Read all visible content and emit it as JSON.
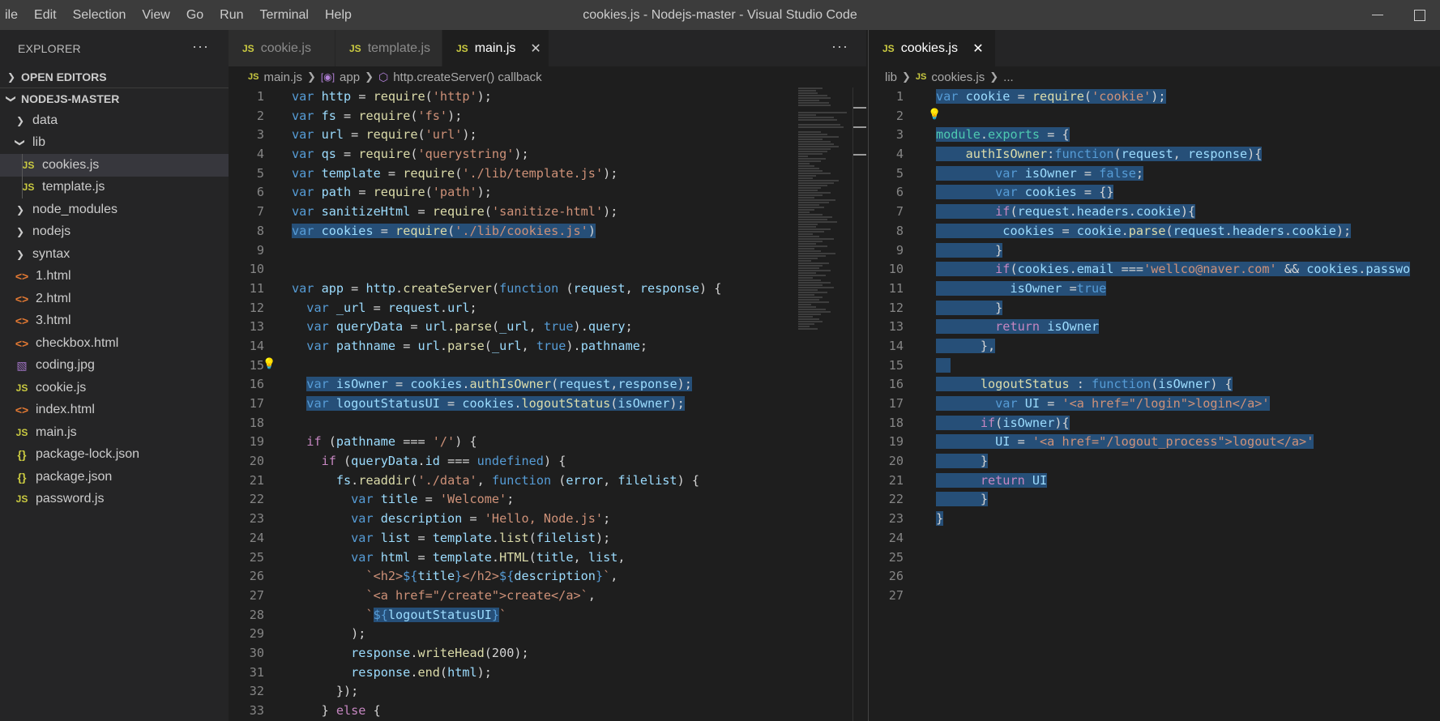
{
  "menu": [
    "ile",
    "Edit",
    "Selection",
    "View",
    "Go",
    "Run",
    "Terminal",
    "Help"
  ],
  "window_title": "cookies.js - Nodejs-master - Visual Studio Code",
  "sidebar": {
    "title": "EXPLORER",
    "more": "···",
    "open_editors": "OPEN EDITORS",
    "project": "NODEJS-MASTER",
    "tree": [
      {
        "label": "data",
        "kind": "folder-closed",
        "depth": 0
      },
      {
        "label": "lib",
        "kind": "folder-open",
        "depth": 0
      },
      {
        "label": "cookies.js",
        "kind": "js",
        "depth": 1,
        "selected": true
      },
      {
        "label": "template.js",
        "kind": "js",
        "depth": 1
      },
      {
        "label": "node_modules",
        "kind": "folder-closed",
        "depth": 0
      },
      {
        "label": "nodejs",
        "kind": "folder-closed",
        "depth": 0
      },
      {
        "label": "syntax",
        "kind": "folder-closed",
        "depth": 0
      },
      {
        "label": "1.html",
        "kind": "html",
        "depth": 0
      },
      {
        "label": "2.html",
        "kind": "html",
        "depth": 0
      },
      {
        "label": "3.html",
        "kind": "html",
        "depth": 0
      },
      {
        "label": "checkbox.html",
        "kind": "html",
        "depth": 0
      },
      {
        "label": "coding.jpg",
        "kind": "img",
        "depth": 0
      },
      {
        "label": "cookie.js",
        "kind": "js",
        "depth": 0
      },
      {
        "label": "index.html",
        "kind": "html",
        "depth": 0
      },
      {
        "label": "main.js",
        "kind": "js",
        "depth": 0
      },
      {
        "label": "package-lock.json",
        "kind": "json",
        "depth": 0
      },
      {
        "label": "package.json",
        "kind": "json",
        "depth": 0
      },
      {
        "label": "password.js",
        "kind": "js",
        "depth": 0
      }
    ]
  },
  "group1": {
    "tabs": [
      {
        "label": "cookie.js",
        "active": false
      },
      {
        "label": "template.js",
        "active": false
      },
      {
        "label": "main.js",
        "active": true
      }
    ],
    "more": "···",
    "breadcrumb": {
      "file": "main.js",
      "scope": "app",
      "callback": "http.createServer() callback"
    },
    "lines": [
      {
        "n": "1",
        "h": "<span class='k'>var</span> <span class='v'>http</span> = <span class='f'>require</span>(<span class='s'>'http'</span>);"
      },
      {
        "n": "2",
        "h": "<span class='k'>var</span> <span class='v'>fs</span> = <span class='f'>require</span>(<span class='s'>'fs'</span>);"
      },
      {
        "n": "3",
        "h": "<span class='k'>var</span> <span class='v'>url</span> = <span class='f'>require</span>(<span class='s'>'url'</span>);"
      },
      {
        "n": "4",
        "h": "<span class='k'>var</span> <span class='v'>qs</span> = <span class='f'>require</span>(<span class='s'>'querystring'</span>);"
      },
      {
        "n": "5",
        "h": "<span class='k'>var</span> <span class='v'>template</span> = <span class='f'>require</span>(<span class='s'>'./lib/template.js'</span>);"
      },
      {
        "n": "6",
        "h": "<span class='k'>var</span> <span class='v'>path</span> = <span class='f'>require</span>(<span class='s'>'path'</span>);"
      },
      {
        "n": "7",
        "h": "<span class='k'>var</span> <span class='v'>sanitizeHtml</span> = <span class='f'>require</span>(<span class='s'>'sanitize-html'</span>);"
      },
      {
        "n": "8",
        "h": "<span class='sel'><span class='k'>var</span> <span class='v'>cookies</span> = <span class='f'>require</span>(<span class='s'>'./lib/cookies.js'</span>)</span>"
      },
      {
        "n": "9",
        "h": ""
      },
      {
        "n": "10",
        "h": ""
      },
      {
        "n": "11",
        "h": "<span class='k'>var</span> <span class='v'>app</span> = <span class='v'>http</span>.<span class='f'>createServer</span>(<span class='k'>function</span> (<span class='v'>request</span>, <span class='v'>response</span>) {"
      },
      {
        "n": "12",
        "h": "  <span class='k'>var</span> <span class='v'>_url</span> = <span class='v'>request</span>.<span class='v'>url</span>;"
      },
      {
        "n": "13",
        "h": "  <span class='k'>var</span> <span class='v'>queryData</span> = <span class='v'>url</span>.<span class='f'>parse</span>(<span class='v'>_url</span>, <span class='k'>true</span>).<span class='v'>query</span>;"
      },
      {
        "n": "14",
        "h": "  <span class='k'>var</span> <span class='v'>pathname</span> = <span class='v'>url</span>.<span class='f'>parse</span>(<span class='v'>_url</span>, <span class='k'>true</span>).<span class='v'>pathname</span>;"
      },
      {
        "n": "15",
        "h": ""
      },
      {
        "n": "16",
        "h": "  <span class='sel'><span class='k'>var</span> <span class='v'>isOwner</span> = <span class='v'>cookies</span>.<span class='f'>authIsOwner</span>(<span class='v'>request</span>,<span class='v'>response</span>);</span>"
      },
      {
        "n": "17",
        "h": "  <span class='sel'><span class='k'>var</span> <span class='v'>logoutStatusUI</span> = <span class='v'>cookies</span>.<span class='f'>logoutStatus</span>(<span class='v'>isOwner</span>);</span>"
      },
      {
        "n": "18",
        "h": ""
      },
      {
        "n": "19",
        "h": "  <span class='c'>if</span> (<span class='v'>pathname</span> === <span class='s'>'/'</span>) {"
      },
      {
        "n": "20",
        "h": "    <span class='c'>if</span> (<span class='v'>queryData</span>.<span class='v'>id</span> === <span class='k'>undefined</span>) {"
      },
      {
        "n": "21",
        "h": "      <span class='v'>fs</span>.<span class='f'>readdir</span>(<span class='s'>'./data'</span>, <span class='k'>function</span> (<span class='v'>error</span>, <span class='v'>filelist</span>) {"
      },
      {
        "n": "22",
        "h": "        <span class='k'>var</span> <span class='v'>title</span> = <span class='s'>'Welcome'</span>;"
      },
      {
        "n": "23",
        "h": "        <span class='k'>var</span> <span class='v'>description</span> = <span class='s'>'Hello, Node.js'</span>;"
      },
      {
        "n": "24",
        "h": "        <span class='k'>var</span> <span class='v'>list</span> = <span class='v'>template</span>.<span class='f'>list</span>(<span class='v'>filelist</span>);"
      },
      {
        "n": "25",
        "h": "        <span class='k'>var</span> <span class='v'>html</span> = <span class='v'>template</span>.<span class='f'>HTML</span>(<span class='v'>title</span>, <span class='v'>list</span>,"
      },
      {
        "n": "26",
        "h": "          <span class='s'>`&lt;h2&gt;</span><span class='k'>${</span><span class='v'>title</span><span class='k'>}</span><span class='s'>&lt;/h2&gt;</span><span class='k'>${</span><span class='v'>description</span><span class='k'>}</span><span class='s'>`</span>,"
      },
      {
        "n": "27",
        "h": "          <span class='s'>`&lt;a href=\"/create\"&gt;create&lt;/a&gt;`</span>,"
      },
      {
        "n": "28",
        "h": "          <span class='s'>`</span><span class='sel'><span class='k'>${</span><span class='v'>logoutStatusUI</span><span class='k'>}</span></span><span class='s'>`</span>"
      },
      {
        "n": "29",
        "h": "        );"
      },
      {
        "n": "30",
        "h": "        <span class='v'>response</span>.<span class='f'>writeHead</span>(<span class='p'>200</span>);"
      },
      {
        "n": "31",
        "h": "        <span class='v'>response</span>.<span class='f'>end</span>(<span class='v'>html</span>);"
      },
      {
        "n": "32",
        "h": "      });"
      },
      {
        "n": "33",
        "h": "    } <span class='c'>else</span> {"
      }
    ]
  },
  "group2": {
    "tabs": [
      {
        "label": "cookies.js",
        "active": true
      }
    ],
    "breadcrumb": {
      "folder": "lib",
      "file": "cookies.js",
      "rest": "..."
    },
    "lines": [
      {
        "n": "1",
        "h": "<span class='sel'><span class='k'>var</span> <span class='v'>cookie</span> = <span class='f'>require</span>(<span class='s'>'cookie'</span>);</span>"
      },
      {
        "n": "2",
        "h": ""
      },
      {
        "n": "3",
        "h": "<span class='sel'><span class='t'>module</span>.<span class='t'>exports</span> = {</span>"
      },
      {
        "n": "4",
        "h": "<span class='sel'>    <span class='f'>authIsOwner</span>:<span class='k'>function</span>(<span class='v'>request</span>, <span class='v'>response</span>){</span>"
      },
      {
        "n": "5",
        "h": "<span class='sel'>        <span class='k'>var</span> <span class='v'>isOwner</span> = <span class='k'>false</span>;</span>"
      },
      {
        "n": "6",
        "h": "<span class='sel'>        <span class='k'>var</span> <span class='v'>cookies</span> = {}</span>"
      },
      {
        "n": "7",
        "h": "<span class='sel'>        <span class='c'>if</span>(<span class='v'>request</span>.<span class='v'>headers</span>.<span class='v'>cookie</span>){</span>"
      },
      {
        "n": "8",
        "h": "<span class='sel'>         <span class='v'>cookies</span> = <span class='v'>cookie</span>.<span class='f'>parse</span>(<span class='v'>request</span>.<span class='v'>headers</span>.<span class='v'>cookie</span>);</span>"
      },
      {
        "n": "9",
        "h": "<span class='sel'>        }</span>"
      },
      {
        "n": "10",
        "h": "<span class='sel'>        <span class='c'>if</span>(<span class='v'>cookies</span>.<span class='v'>email</span> ===<span class='s'>'wellco@naver.com'</span> &amp;&amp; <span class='v'>cookies</span>.<span class='v'>passwo</span></span>"
      },
      {
        "n": "11",
        "h": "<span class='sel'>          <span class='v'>isOwner</span> =<span class='k'>true</span></span>"
      },
      {
        "n": "12",
        "h": "<span class='sel'>        }</span>"
      },
      {
        "n": "13",
        "h": "<span class='sel'>        <span class='c'>return</span> <span class='v'>isOwner</span></span>"
      },
      {
        "n": "14",
        "h": "<span class='sel'>      },</span>"
      },
      {
        "n": "15",
        "h": "<span class='sel'>  </span>"
      },
      {
        "n": "16",
        "h": "<span class='sel'>      <span class='f'>logoutStatus</span> : <span class='k'>function</span>(<span class='v'>isOwner</span>) {</span>"
      },
      {
        "n": "17",
        "h": "<span class='sel'>        <span class='k'>var</span> <span class='v'>UI</span> = <span class='s'>'&lt;a href=\"/login\"&gt;login&lt;/a&gt;'</span></span>"
      },
      {
        "n": "18",
        "h": "<span class='sel'>      <span class='c'>if</span>(<span class='v'>isOwner</span>){</span>"
      },
      {
        "n": "19",
        "h": "<span class='sel'>        <span class='v'>UI</span> = <span class='s'>'&lt;a href=\"/logout_process\"&gt;logout&lt;/a&gt;'</span></span>"
      },
      {
        "n": "20",
        "h": "<span class='sel'>      }</span>"
      },
      {
        "n": "21",
        "h": "<span class='sel'>      <span class='c'>return</span> <span class='v'>UI</span></span>"
      },
      {
        "n": "22",
        "h": "<span class='sel'>      }</span>"
      },
      {
        "n": "23",
        "h": "<span class='sel'>}</span>"
      },
      {
        "n": "24",
        "h": ""
      },
      {
        "n": "25",
        "h": ""
      },
      {
        "n": "26",
        "h": ""
      },
      {
        "n": "27",
        "h": ""
      }
    ]
  },
  "colors": {
    "selection": "#264f78",
    "keyword": "#569cd6",
    "string": "#ce9178",
    "variable": "#9cdcfe",
    "function": "#dcdcaa",
    "control": "#c586c0"
  }
}
